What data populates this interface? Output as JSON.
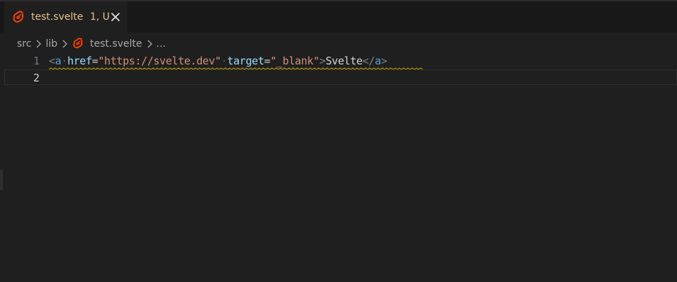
{
  "tab": {
    "filename": "test.svelte",
    "status": "1, U",
    "icon": "svelte-icon",
    "close_icon": "close-icon"
  },
  "breadcrumb": {
    "items": [
      "src",
      "lib",
      "test.svelte",
      "..."
    ],
    "separator_icon": "chevron-right-icon"
  },
  "editor": {
    "line_numbers": [
      "1",
      "2"
    ],
    "active_line": 2,
    "line1_tokens": {
      "open_bracket": "<",
      "tag": "a",
      "ws1": "·",
      "attr1": "href",
      "eq1": "=",
      "val1": "\"https://svelte.dev\"",
      "ws2": "·",
      "attr2": "target",
      "eq2": "=",
      "val2": "\"_blank\"",
      "close_bracket": ">",
      "text": "Svelte",
      "end_open": "</",
      "end_tag": "a",
      "end_close": ">"
    }
  },
  "colors": {
    "accent_modified": "#e2c08d",
    "svelte": "#ff3e00",
    "squiggle_warning": "#cca700",
    "background": "#1f1f1f"
  }
}
